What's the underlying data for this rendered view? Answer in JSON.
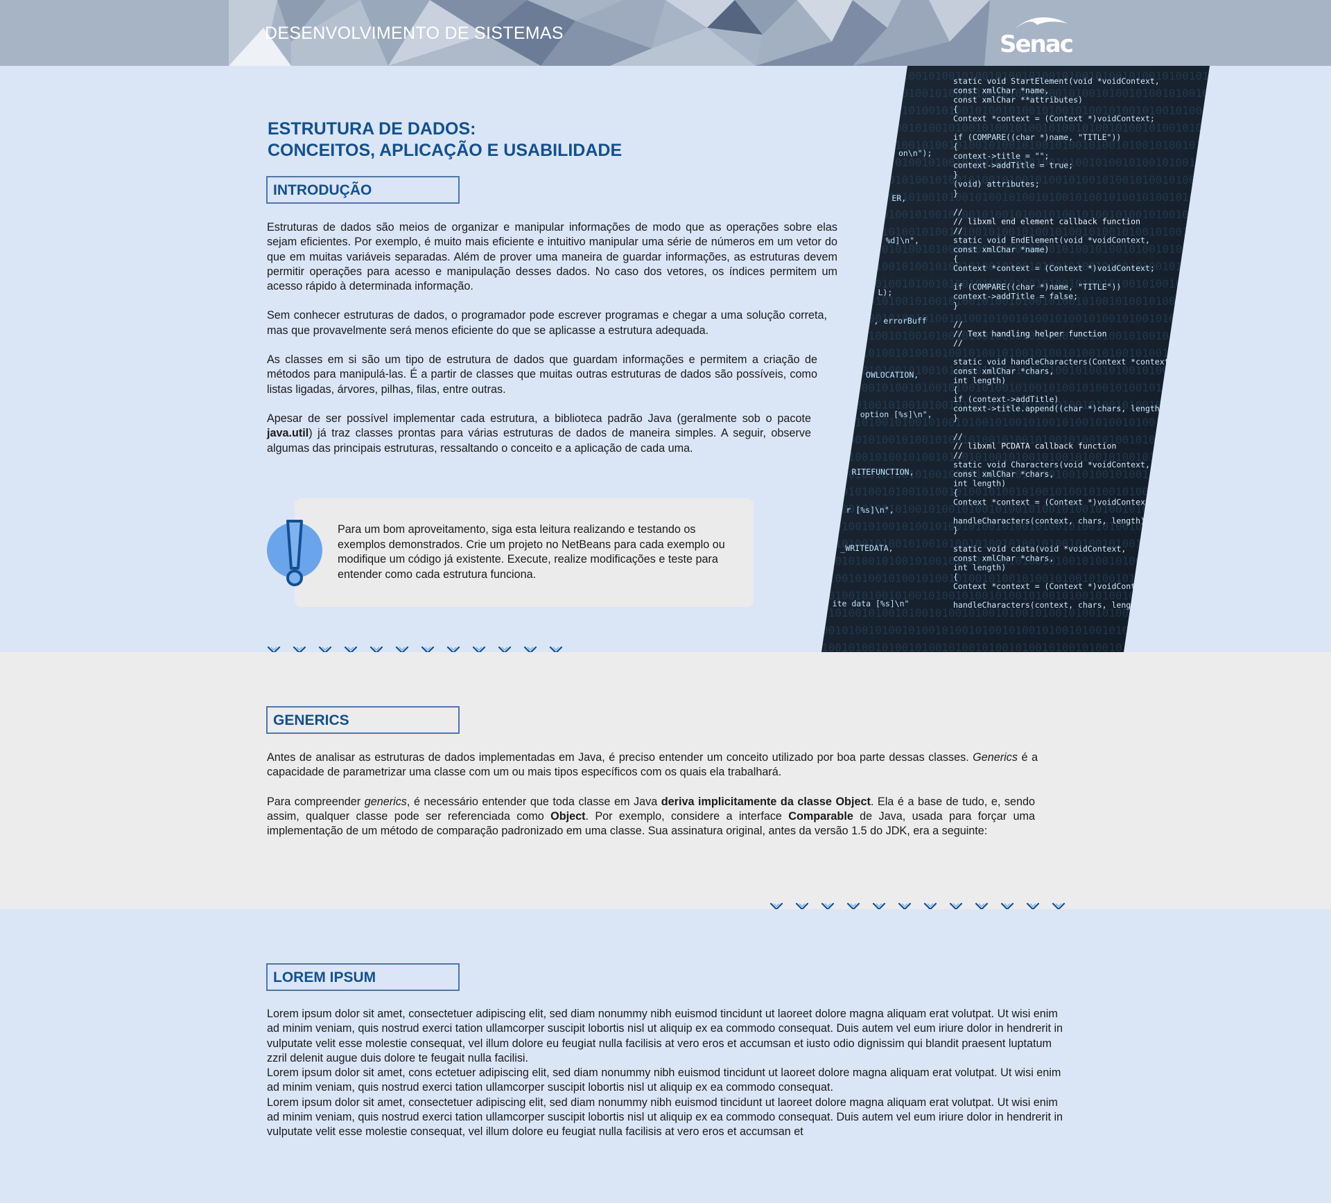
{
  "header": {
    "title": "DESENVOLVIMENTO DE SISTEMAS",
    "logo_text": "Senac"
  },
  "main": {
    "title_line1": "ESTRUTURA DE DADOS:",
    "title_line2": "CONCEITOS, APLICAÇÃO E USABILIDADE"
  },
  "intro": {
    "heading": "INTRODUÇÃO",
    "p1": "Estruturas de dados são meios de organizar e manipular informações de modo que as operações sobre elas sejam eficientes. Por exemplo, é muito mais eficiente e intuitivo manipular uma série de números em um vetor do que em muitas variáveis separadas. Além de prover uma maneira de guardar informações, as estruturas devem permitir operações para acesso e manipulação desses dados. No caso dos vetores, os índices permitem um acesso rápido à determinada informação.",
    "p2": "Sem conhecer estruturas de dados, o programador pode escrever programas e chegar a uma solução correta, mas que provavelmente será menos eficiente do que se aplicasse a estrutura adequada.",
    "p3": "As classes em si são um tipo de estrutura de dados que guardam informações e permitem a criação de métodos para manipulá-las. É a partir de classes que muitas outras estruturas de dados são possíveis, como listas ligadas, árvores, pilhas, filas, entre outras.",
    "p4_a": "Apesar de ser possível implementar cada estrutura, a biblioteca padrão Java (geralmente sob o pacote ",
    "p4_b": "java.util",
    "p4_c": ") já traz classes prontas para várias estruturas de dados de maneira simples. A seguir, observe algumas das principais estruturas, ressaltando o conceito e a aplicação de cada uma."
  },
  "callout": {
    "text": "Para um bom aproveitamento, siga esta leitura realizando e testando os exemplos demonstrados. Crie um projeto no NetBeans para cada exemplo ou modifique um código já existente. Execute, realize modificações e teste para entender como cada estrutura funciona.",
    "icon": "exclamation-icon"
  },
  "generics": {
    "heading": "GENERICS",
    "p1_a": "Antes de analisar as estruturas de dados implementadas em Java, é preciso entender um conceito utilizado por boa parte dessas classes. ",
    "p1_b": "Generics",
    "p1_c": " é a capacidade de parametrizar uma classe com um ou mais tipos específicos com os quais ela trabalhará.",
    "p2_a": "Para compreender ",
    "p2_b": "generics",
    "p2_c": ", é necessário entender que toda classe em Java ",
    "p2_d": "deriva implicitamente da classe Object",
    "p2_e": ". Ela é a base de tudo, e, sendo assim, qualquer classe pode ser referenciada como ",
    "p2_f": "Object",
    "p2_g": ". Por exemplo, considere a interface ",
    "p2_h": "Comparable",
    "p2_i": " de Java, usada para forçar uma implementação de um método de comparação padronizado em uma classe. Sua assinatura original, antes da versão 1.5 do JDK, era a seguinte:"
  },
  "lorem": {
    "heading": "LOREM IPSUM",
    "p1": "Lorem ipsum dolor sit amet, consectetuer adipiscing elit, sed diam nonummy nibh euismod tincidunt ut laoreet dolore magna aliquam erat volutpat. Ut wisi enim ad minim veniam, quis nostrud exerci tation ullamcorper suscipit lobortis nisl ut aliquip ex ea commodo consequat. Duis autem vel eum iriure dolor in hendrerit in vulputate velit esse molestie consequat, vel illum dolore eu feugiat nulla facilisis at vero eros et accumsan et iusto odio dignissim qui blandit praesent luptatum zzril delenit augue duis dolore te feugait nulla facilisi.",
    "p2": "Lorem ipsum dolor sit amet, cons ectetuer adipiscing elit, sed diam nonummy nibh euismod tincidunt ut laoreet dolore magna aliquam erat volutpat. Ut wisi enim ad minim veniam, quis nostrud exerci tation ullamcorper suscipit lobortis nisl ut aliquip ex ea commodo consequat.",
    "p3": "Lorem ipsum dolor sit amet, consectetuer adipiscing elit, sed diam nonummy nibh euismod tincidunt ut laoreet dolore magna aliquam erat volutpat. Ut wisi enim ad minim veniam, quis nostrud exerci tation ullamcorper suscipit lobortis nisl ut aliquip ex ea commodo consequat. Duis autem vel eum iriure dolor in hendrerit in vulputate velit esse molestie consequat, vel illum dolore eu feugiat nulla facilisis at vero eros et accumsan et"
  },
  "code_image": {
    "lines": [
      "static void StartElement(void *voidContext,",
      "                  const xmlChar *name,",
      "                  const xmlChar **attributes)",
      "{",
      "  Context *context = (Context *)voidContext;",
      "",
      "  if (COMPARE((char *)name, \"TITLE\"))",
      "  {",
      "    context->title = \"\";",
      "    context->addTitle = true;",
      "  }",
      "  (void) attributes;",
      "}",
      "",
      "//",
      "//  libxml end element callback function",
      "//",
      "static void EndElement(void *voidContext,",
      "                  const xmlChar *name)",
      "{",
      "  Context *context = (Context *)voidContext;",
      "",
      "  if (COMPARE((char *)name, \"TITLE\"))",
      "    context->addTitle = false;",
      "}",
      "",
      "//",
      "//  Text handling helper function",
      "//",
      "",
      "static void handleCharacters(Context *context,",
      "                  const xmlChar *chars,",
      "                  int length)",
      "{",
      "  if (context->addTitle)",
      "    context->title.append((char *)chars, length);",
      "}",
      "",
      "//",
      "//  libxml PCDATA callback function",
      "//",
      "static void Characters(void *voidContext,",
      "                  const xmlChar *chars,",
      "                  int length)",
      "{",
      "  Context *context = (Context *)voidContext;",
      "",
      "  handleCharacters(context, chars, length);",
      "}",
      "",
      "static void cdata(void *voidContext,",
      "                  const xmlChar *chars,",
      "                  int length)",
      "{",
      "  Context *context = (Context *)voidContext;",
      "",
      "  handleCharacters(context, chars, length);"
    ],
    "left_fragments": [
      "on\\n\");",
      "ER,",
      "%d]\\n\",",
      "L);",
      ", errorBuff",
      "OWLOCATION,",
      "option [%s]\\n\",",
      "RITEFUNCTION,",
      "r [%s]\\n\",",
      "_WRITEDATA,",
      "ite data [%s]\\n\""
    ]
  },
  "colors": {
    "header_bg": "#a7b4c6",
    "light_blue_bg": "#dae6f5",
    "grey_bg": "#ececec",
    "heading_blue": "#124f93",
    "box_border": "#4f75ad",
    "callout_bg": "#ebebeb",
    "icon_blue": "#6aa4ea"
  }
}
